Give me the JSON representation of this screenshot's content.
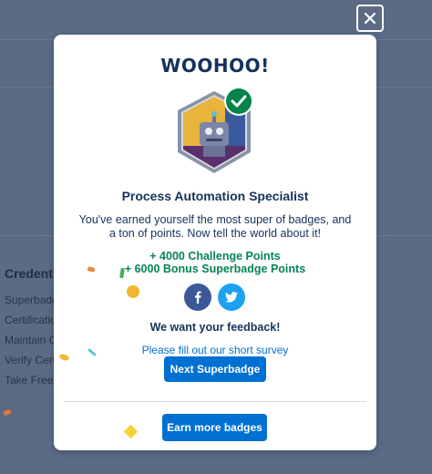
{
  "background": {
    "heading": "Credentia",
    "links": [
      "Superbadg",
      "Certificatio",
      "Maintain C",
      "Verify Certi",
      "Take Free C"
    ]
  },
  "close_icon": "close-icon",
  "modal": {
    "title": "WOOHOO!",
    "badge_icon": "robot-badge-icon",
    "check_icon": "check-icon",
    "badge_name": "Process Automation Specialist",
    "message": "You've earned yourself the most super of badges, and a ton of points. Now tell the world about it!",
    "points": [
      "+ 4000 Challenge Points",
      "+ 6000 Bonus Superbadge Points"
    ],
    "share": {
      "facebook_icon": "facebook-icon",
      "twitter_icon": "twitter-icon"
    },
    "feedback_heading": "We want your feedback!",
    "survey_link": "Please fill out our short survey",
    "next_button": "Next Superbadge",
    "more_button": "Earn more badges"
  },
  "colors": {
    "overlay": "#5b6b86",
    "title": "#16325c",
    "points": "#048553",
    "brand_button": "#0070d2",
    "facebook": "#3b5998",
    "twitter": "#1da1f2"
  }
}
